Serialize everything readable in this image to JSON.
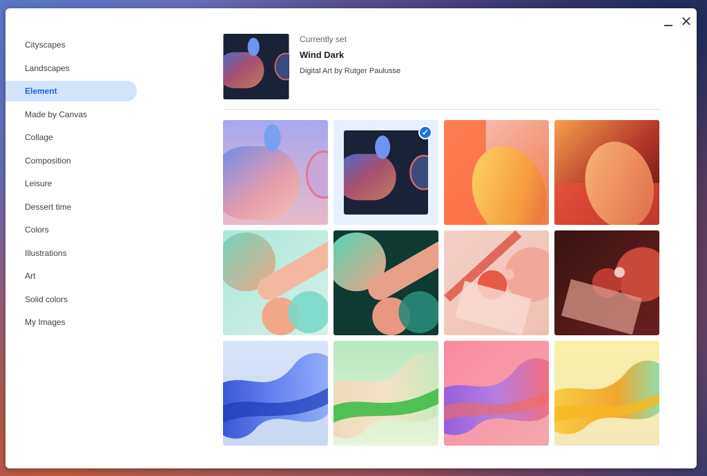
{
  "window": {
    "minimize_icon": "minimize-icon",
    "close_icon": "close-icon",
    "close_glyph": "✕"
  },
  "sidebar": {
    "items": [
      {
        "label": "Cityscapes",
        "active": false
      },
      {
        "label": "Landscapes",
        "active": false
      },
      {
        "label": "Element",
        "active": true
      },
      {
        "label": "Made by Canvas",
        "active": false
      },
      {
        "label": "Collage",
        "active": false
      },
      {
        "label": "Composition",
        "active": false
      },
      {
        "label": "Leisure",
        "active": false
      },
      {
        "label": "Dessert time",
        "active": false
      },
      {
        "label": "Colors",
        "active": false
      },
      {
        "label": "Illustrations",
        "active": false
      },
      {
        "label": "Art",
        "active": false
      },
      {
        "label": "Solid colors",
        "active": false
      },
      {
        "label": "My Images",
        "active": false
      }
    ],
    "accent": "#1967d2",
    "active_background": "#d2e3fc"
  },
  "current": {
    "label": "Currently set",
    "title": "Wind Dark",
    "credit": "Digital Art by Rutger Paulusse"
  },
  "grid": {
    "selected_index": 1,
    "check_icon": "check-circle-icon",
    "check_glyph": "✓"
  }
}
